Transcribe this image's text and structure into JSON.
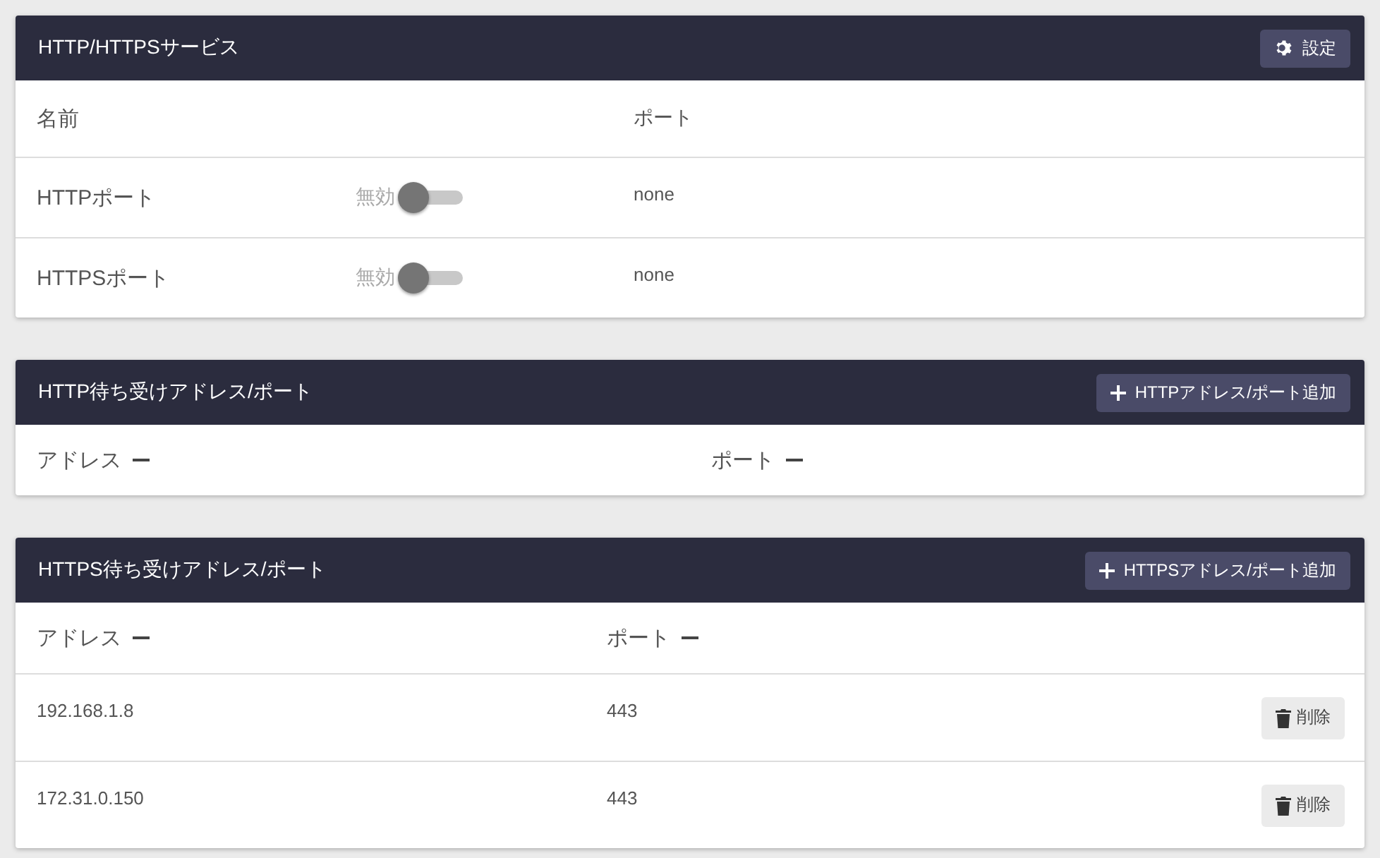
{
  "services": {
    "title": "HTTP/HTTPSサービス",
    "settings_button": "設定",
    "columns": [
      "名前",
      "ポート"
    ],
    "rows": [
      {
        "name": "HTTPポート",
        "toggle_label": "無効",
        "on": false,
        "port": "none"
      },
      {
        "name": "HTTPSポート",
        "toggle_label": "無効",
        "on": false,
        "port": "none"
      }
    ]
  },
  "http_listen": {
    "title": "HTTP待ち受けアドレス/ポート",
    "add_button": "HTTPアドレス/ポート追加",
    "columns": [
      "アドレス",
      "ポート"
    ]
  },
  "https_listen": {
    "title": "HTTPS待ち受けアドレス/ポート",
    "add_button": "HTTPSアドレス/ポート追加",
    "columns": [
      "アドレス",
      "ポート"
    ],
    "rows": [
      {
        "address": "192.168.1.8",
        "port": "443",
        "delete_button": "削除"
      },
      {
        "address": "172.31.0.150",
        "port": "443",
        "delete_button": "削除"
      }
    ]
  }
}
